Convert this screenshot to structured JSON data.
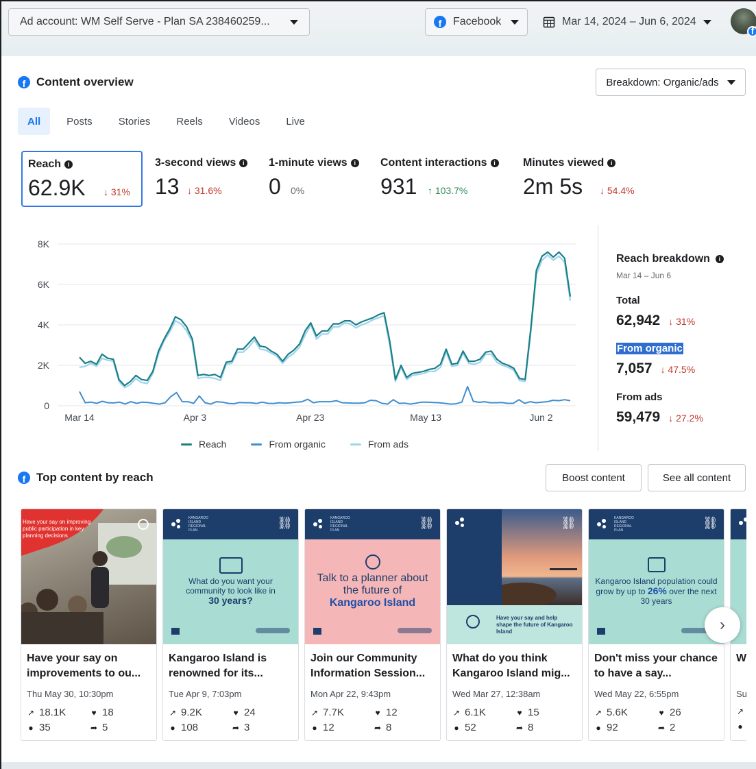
{
  "header": {
    "ad_account": "Ad account: WM Self Serve - Plan SA 238460259...",
    "platform": "Facebook",
    "date_range": "Mar 14, 2024 – Jun 6, 2024"
  },
  "overview": {
    "title": "Content overview",
    "breakdown_button": "Breakdown: Organic/ads",
    "tabs": [
      "All",
      "Posts",
      "Stories",
      "Reels",
      "Videos",
      "Live"
    ],
    "active_tab": "All",
    "metrics": [
      {
        "label": "Reach",
        "value": "62.9K",
        "change": "↓ 31%",
        "direction": "down"
      },
      {
        "label": "3-second views",
        "value": "13",
        "change": "↓ 31.6%",
        "direction": "down"
      },
      {
        "label": "1-minute views",
        "value": "0",
        "change": "0%",
        "direction": "flat"
      },
      {
        "label": "Content interactions",
        "value": "931",
        "change": "↑ 103.7%",
        "direction": "up"
      },
      {
        "label": "Minutes viewed",
        "value": "2m 5s",
        "change": "↓ 54.4%",
        "direction": "down"
      }
    ]
  },
  "chart_data": {
    "type": "line",
    "title": "",
    "xlabel": "",
    "ylabel": "",
    "x_tick_labels": [
      "Mar 14",
      "Apr 3",
      "Apr 23",
      "May 13",
      "Jun 2"
    ],
    "y_tick_labels": [
      "0",
      "2K",
      "4K",
      "6K",
      "8K"
    ],
    "ylim": [
      0,
      8000
    ],
    "grid": true,
    "legend_position": "bottom",
    "x_start": "2024-03-14",
    "series": [
      {
        "name": "Reach",
        "color": "#1a7f85",
        "values": [
          2400,
          2100,
          2200,
          2050,
          2550,
          2350,
          2300,
          1300,
          1000,
          1200,
          1500,
          1300,
          1250,
          1700,
          2700,
          3300,
          3800,
          4400,
          4250,
          3900,
          3300,
          1500,
          1550,
          1500,
          1550,
          1400,
          2150,
          2200,
          2800,
          2800,
          3100,
          3400,
          2950,
          2900,
          2700,
          2550,
          2200,
          2550,
          2750,
          3050,
          3700,
          4100,
          3450,
          3700,
          3700,
          4050,
          4050,
          4200,
          4200,
          4000,
          4150,
          4250,
          4350,
          4500,
          4600,
          3200,
          1300,
          2000,
          1400,
          1600,
          1650,
          1700,
          1800,
          1850,
          2050,
          2800,
          2050,
          2100,
          2700,
          2200,
          2200,
          2300,
          2650,
          2700,
          2300,
          2100,
          2000,
          1850,
          1350,
          1300,
          3800,
          6700,
          7400,
          7600,
          7350,
          7600,
          7300,
          5400
        ]
      },
      {
        "name": "From organic",
        "color": "#3e8ed0",
        "values": [
          700,
          150,
          180,
          120,
          220,
          150,
          140,
          180,
          80,
          200,
          120,
          180,
          160,
          120,
          80,
          150,
          450,
          650,
          200,
          200,
          120,
          480,
          150,
          80,
          200,
          180,
          120,
          100,
          160,
          150,
          150,
          110,
          180,
          120,
          110,
          150,
          130,
          150,
          180,
          200,
          320,
          150,
          200,
          200,
          200,
          250,
          150,
          140,
          130,
          130,
          150,
          270,
          250,
          120,
          80,
          300,
          120,
          130,
          80,
          130,
          180,
          180,
          160,
          150,
          120,
          80,
          100,
          180,
          950,
          220,
          170,
          200,
          150,
          150,
          160,
          120,
          120,
          300,
          120,
          200,
          150,
          180,
          200,
          270,
          250,
          300,
          250
        ]
      },
      {
        "name": "From ads",
        "color": "#9fd3ee",
        "values": [
          1900,
          1950,
          2100,
          1950,
          2350,
          2250,
          2200,
          1200,
          900,
          1050,
          1350,
          1150,
          1100,
          1600,
          2550,
          3200,
          3650,
          4200,
          4050,
          3700,
          3150,
          1350,
          1400,
          1400,
          1350,
          1250,
          2050,
          2100,
          2650,
          2650,
          2900,
          3250,
          2800,
          2750,
          2600,
          2450,
          2100,
          2400,
          2600,
          2900,
          3500,
          4000,
          3300,
          3550,
          3550,
          3900,
          3900,
          4100,
          4050,
          3850,
          4000,
          4100,
          4250,
          4350,
          4450,
          3000,
          1200,
          1900,
          1300,
          1500,
          1550,
          1600,
          1700,
          1700,
          1900,
          2650,
          1950,
          2000,
          2600,
          2100,
          2050,
          2150,
          2550,
          2550,
          2150,
          2000,
          1900,
          1750,
          1250,
          1200,
          3600,
          6500,
          7200,
          7450,
          7200,
          7400,
          7100,
          5200
        ]
      }
    ]
  },
  "breakdown": {
    "title": "Reach breakdown",
    "range": "Mar 14 – Jun 6",
    "total_label": "Total",
    "total_value": "62,942",
    "total_change": "↓ 31%",
    "organic_label": "From organic",
    "organic_value": "7,057",
    "organic_change": "↓ 47.5%",
    "ads_label": "From ads",
    "ads_value": "59,479",
    "ads_change": "↓ 27.2%"
  },
  "top_content": {
    "title": "Top content by reach",
    "boost_button": "Boost content",
    "see_all_button": "See all content",
    "cards": [
      {
        "title": "Have your say on improvements to ou...",
        "date": "Thu May 30, 10:30pm",
        "reach": "18.1K",
        "likes": "18",
        "comments": "35",
        "shares": "5",
        "thumb_text": "Have your say on improving public participation in key planning decisions"
      },
      {
        "title": "Kangaroo Island is renowned for its...",
        "date": "Tue Apr 9, 7:03pm",
        "reach": "9.2K",
        "likes": "24",
        "comments": "108",
        "shares": "3",
        "thumb_text": "What do you want your community to look like in",
        "thumb_emph": "30 years?"
      },
      {
        "title": "Join our Community Information Session...",
        "date": "Mon Apr 22, 9:43pm",
        "reach": "7.7K",
        "likes": "12",
        "comments": "12",
        "shares": "8",
        "thumb_text": "Talk to a planner about the future of",
        "thumb_emph": "Kangaroo Island"
      },
      {
        "title": "What do you think Kangaroo Island mig...",
        "date": "Wed Mar 27, 12:38am",
        "reach": "6.1K",
        "likes": "15",
        "comments": "52",
        "shares": "8",
        "thumb_text": "Have your say and help shape the future of Kangaroo Island"
      },
      {
        "title": "Don't miss your chance to have a say...",
        "date": "Wed May 22, 6:55pm",
        "reach": "5.6K",
        "likes": "26",
        "comments": "92",
        "shares": "2",
        "thumb_text": "Kangaroo Island population could grow by up to",
        "thumb_emph": "26%",
        "thumb_text2": "over the next 30 years"
      },
      {
        "title": "W... to...",
        "date": "Su...",
        "reach": "",
        "likes": "",
        "comments": "",
        "shares": ""
      }
    ]
  },
  "colors": {
    "accent": "#1877f2",
    "selected_border": "#3578e5",
    "down": "#c0392b",
    "up": "#2e8b57"
  }
}
